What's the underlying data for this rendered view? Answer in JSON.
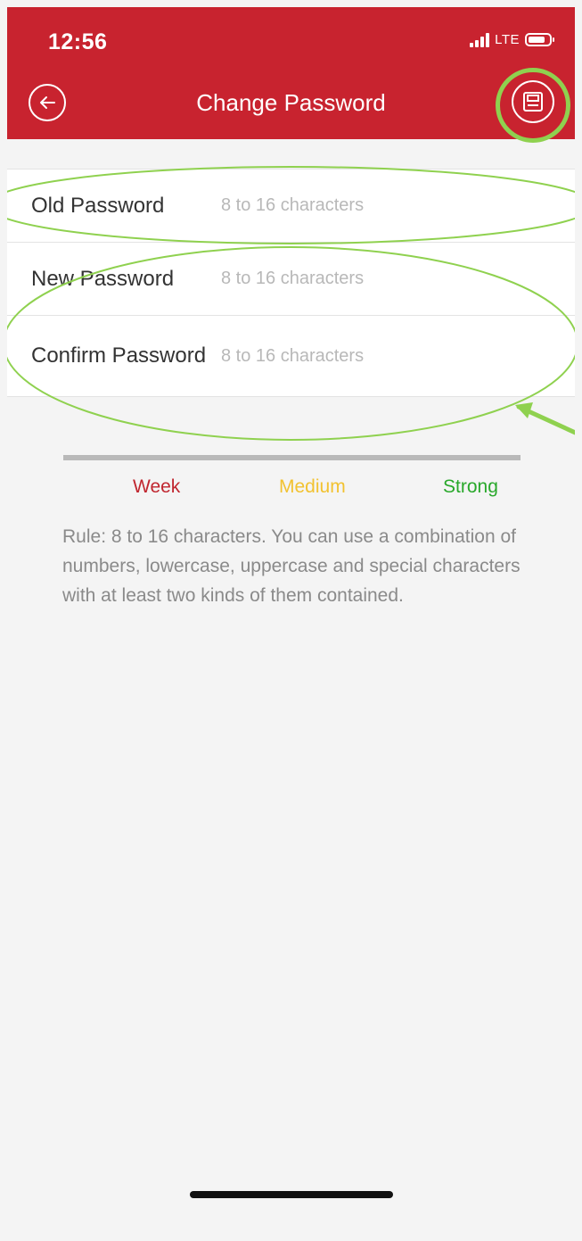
{
  "status_bar": {
    "time": "12:56",
    "network": "LTE"
  },
  "header": {
    "title": "Change Password",
    "back_icon": "arrow-left-circle-icon",
    "save_icon": "save-disk-icon"
  },
  "form": {
    "fields": [
      {
        "label": "Old Password",
        "placeholder": "8 to 16 characters",
        "value": ""
      },
      {
        "label": "New Password",
        "placeholder": "8 to 16 characters",
        "value": ""
      },
      {
        "label": "Confirm Password",
        "placeholder": "8 to 16 characters",
        "value": ""
      }
    ]
  },
  "strength": {
    "weak_label": "Week",
    "medium_label": "Medium",
    "strong_label": "Strong",
    "weak_color": "#c0262f",
    "medium_color": "#f2c230",
    "strong_color": "#29a82b"
  },
  "rule": {
    "text": "Rule: 8 to 16 characters. You can use a combination of numbers, lowercase, uppercase and special characters with at least two kinds of them contained."
  },
  "colors": {
    "header_bg": "#c8232f",
    "annotation": "#8fd14f",
    "page_bg": "#f4f4f4"
  }
}
